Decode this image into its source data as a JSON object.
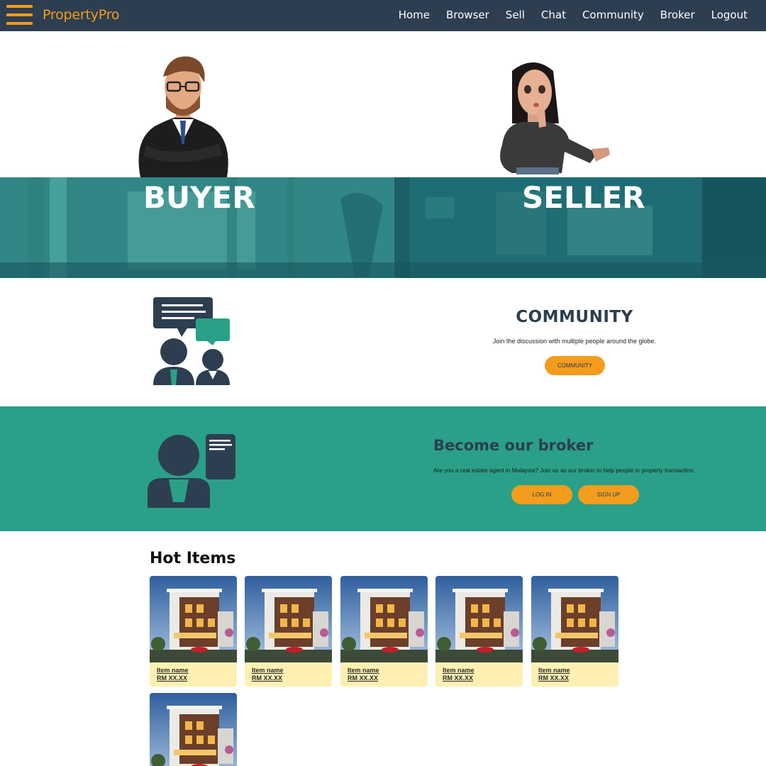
{
  "nav": {
    "brand": "PropertyPro",
    "links": [
      "Home",
      "Browser",
      "Sell",
      "Chat",
      "Community",
      "Broker",
      "Logout"
    ]
  },
  "hero": {
    "buyer_label": "BUYER",
    "seller_label": "SELLER"
  },
  "community": {
    "title": "COMMUNITY",
    "text": "Join the discussion with multiple people around the globe.",
    "button": "COMMUNITY"
  },
  "broker": {
    "title": "Become our broker",
    "text": "Are you a real estate agent in Malaysia? Join us as our broker to help people in property transaction.",
    "login_button": "LOG IN",
    "signup_button": "SIGN UP"
  },
  "hot_items": {
    "title": "Hot Items",
    "items": [
      {
        "name": "Item name",
        "price": "RM XX.XX"
      },
      {
        "name": "Item name",
        "price": "RM XX.XX"
      },
      {
        "name": "Item name",
        "price": "RM XX.XX"
      },
      {
        "name": "Item name",
        "price": "RM XX.XX"
      },
      {
        "name": "Item name",
        "price": "RM XX.XX"
      },
      {
        "name": "",
        "price": ""
      }
    ]
  },
  "colors": {
    "nav_bg": "#2d3e50",
    "accent": "#f39c1e",
    "teal": "#2aa088",
    "card_bg": "#fdf0b2"
  }
}
